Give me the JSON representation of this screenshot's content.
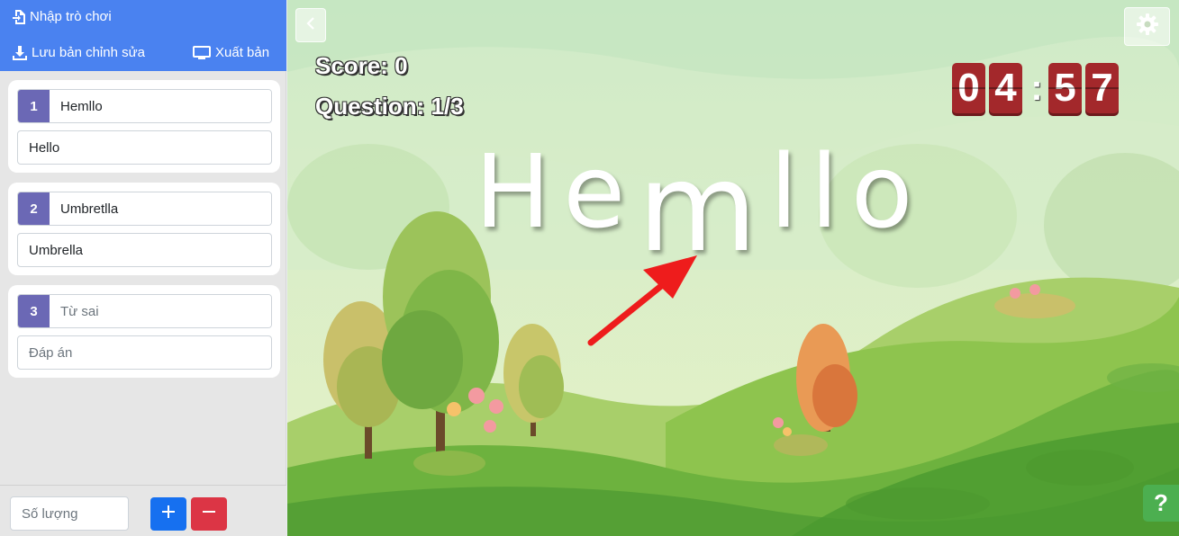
{
  "sidebar": {
    "import_label": "Nhập trò chơi",
    "save_label": "Lưu bản chỉnh sửa",
    "publish_label": "Xuất bản",
    "questions": [
      {
        "number": "1",
        "word": "Hemllo",
        "answer": "Hello"
      },
      {
        "number": "2",
        "word": "Umbretlla",
        "answer": "Umbrella"
      },
      {
        "number": "3",
        "word": "",
        "word_placeholder": "Từ sai",
        "answer": "",
        "answer_placeholder": "Đáp án"
      }
    ],
    "quantity_placeholder": "Số lượng",
    "add_icon": "plus-icon",
    "remove_icon": "minus-icon"
  },
  "game": {
    "score_text": "Score: 0",
    "question_text": "Question: 1/3",
    "timer": {
      "d1": "0",
      "d2": "4",
      "separator": ":",
      "d3": "5",
      "d4": "7"
    },
    "letters": [
      "H",
      "e",
      "m",
      "l",
      "l",
      "o"
    ],
    "raised_letter_index": 2,
    "help_label": "?",
    "colors": {
      "accent": "#4a82f0",
      "timer": "#a3282b",
      "add": "#1670f0",
      "remove": "#dc3545",
      "badge": "#6b68b5",
      "help": "#4caf50",
      "arrow": "#ee1c1c"
    }
  }
}
